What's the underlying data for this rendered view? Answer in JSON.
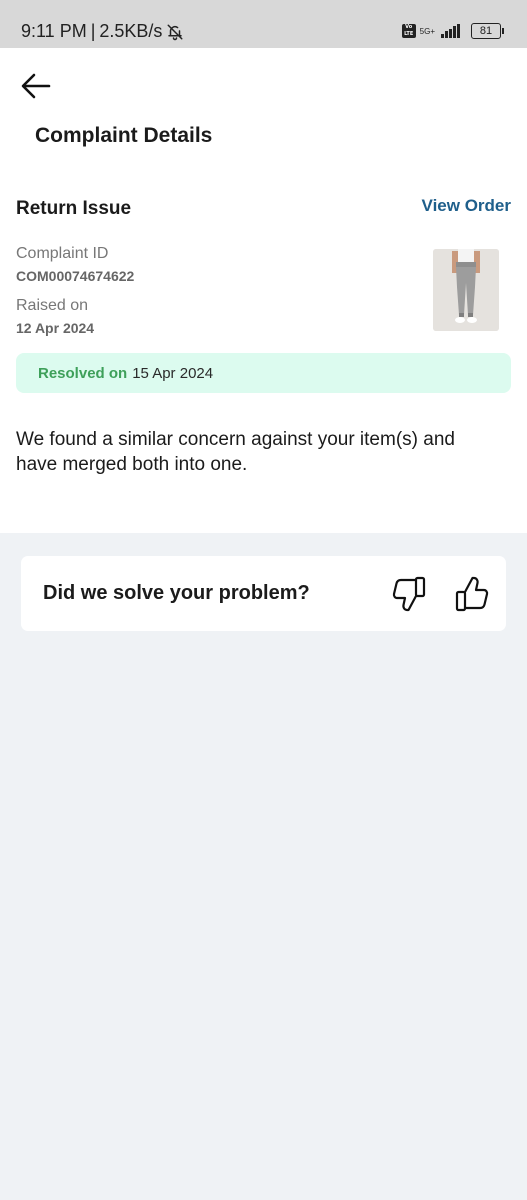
{
  "status_bar": {
    "time": "9:11 PM",
    "separator": "|",
    "speed": "2.5KB/s",
    "network": "5G+",
    "volte": "Vo LTE",
    "battery": "81"
  },
  "header": {
    "title": "Complaint Details"
  },
  "complaint": {
    "issue_type": "Return Issue",
    "view_order_label": "View Order",
    "id_label": "Complaint ID",
    "id_value": "COM00074674622",
    "raised_label": "Raised on",
    "raised_value": "12 Apr 2024",
    "resolved_label": "Resolved on",
    "resolved_date": "15 Apr 2024",
    "message": "We found a similar concern against your item(s) and have merged both into one."
  },
  "feedback": {
    "question": "Did we solve your problem?"
  },
  "colors": {
    "accent_link": "#1f5f8b",
    "resolved_green": "#3ea05a",
    "resolved_bg": "#dcfbef",
    "page_bg": "#eff2f5"
  }
}
